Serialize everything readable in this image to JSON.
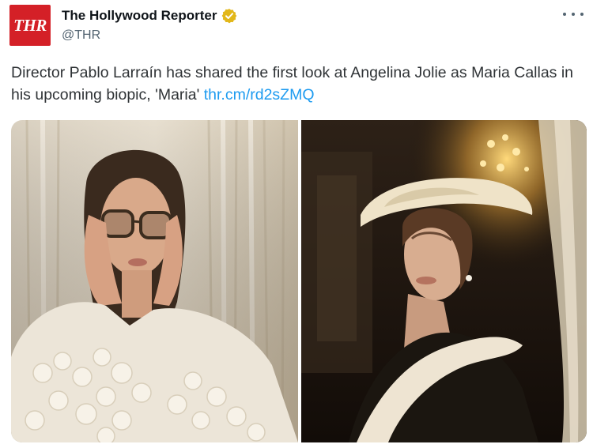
{
  "account": {
    "avatar_text": "THR",
    "display_name": "The Hollywood Reporter",
    "handle": "@THR",
    "verified_badge_color": "#e2b719",
    "avatar_color": "#d42027"
  },
  "tweet": {
    "text": "Director Pablo Larraín has shared the first look at Angelina Jolie as Maria Callas in his upcoming biopic, 'Maria'",
    "link_text": "thr.cm/rd2sZMQ"
  },
  "media": {
    "photos": [
      {
        "subject": "woman-in-glasses-photo"
      },
      {
        "subject": "woman-in-hat-photo"
      }
    ]
  },
  "icons": {
    "more": "more-options-icon",
    "verified": "verified-badge-icon"
  }
}
